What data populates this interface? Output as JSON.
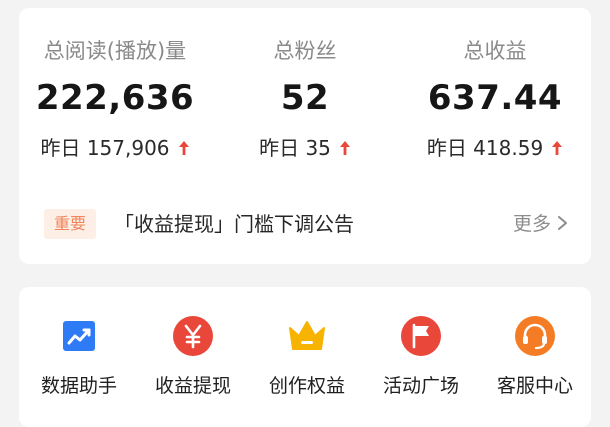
{
  "stats": [
    {
      "label": "总阅读(播放)量",
      "value": "222,636",
      "yesterday": "昨日 157,906"
    },
    {
      "label": "总粉丝",
      "value": "52",
      "yesterday": "昨日 35"
    },
    {
      "label": "总收益",
      "value": "637.44",
      "yesterday": "昨日 418.59"
    }
  ],
  "trend_icon": "arrow-up-icon",
  "colors": {
    "accent_red": "#e9473a",
    "badge_bg": "#fdeee6",
    "badge_text": "#f0865c",
    "chart_blue": "#2f7bf6",
    "crown_yellow": "#f6b300",
    "support_orange": "#f47c24"
  },
  "notice": {
    "badge": "重要",
    "text": "「收益提现」门槛下调公告",
    "more": "更多"
  },
  "tools": [
    {
      "label": "数据助手",
      "icon": "chart-icon"
    },
    {
      "label": "收益提现",
      "icon": "yuan-icon"
    },
    {
      "label": "创作权益",
      "icon": "crown-icon"
    },
    {
      "label": "活动广场",
      "icon": "flag-icon"
    },
    {
      "label": "客服中心",
      "icon": "headset-icon"
    }
  ]
}
